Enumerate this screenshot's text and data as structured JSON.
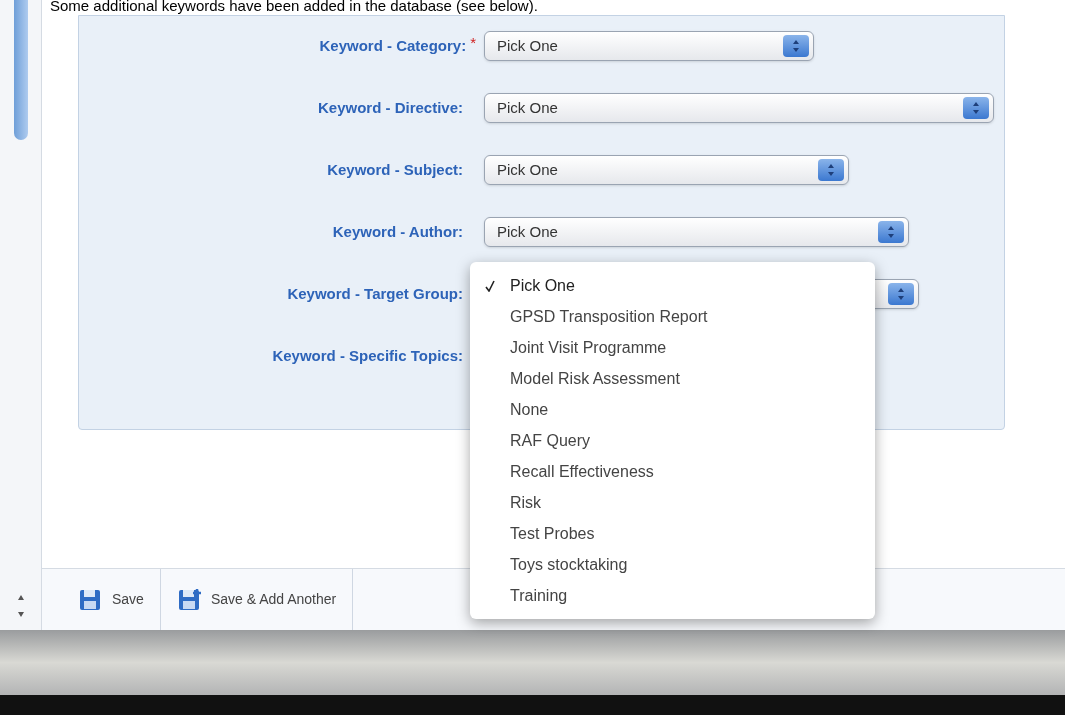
{
  "intro": "Some additional keywords have been added in the database (see below).",
  "fields": [
    {
      "label": "Keyword - Category:",
      "required": true,
      "value": "Pick One"
    },
    {
      "label": "Keyword - Directive:",
      "required": false,
      "value": "Pick One"
    },
    {
      "label": "Keyword - Subject:",
      "required": false,
      "value": "Pick One"
    },
    {
      "label": "Keyword - Author:",
      "required": false,
      "value": "Pick One"
    },
    {
      "label": "Keyword - Target Group:",
      "required": false
    },
    {
      "label": "Keyword - Specific Topics:",
      "required": false
    }
  ],
  "menu": [
    {
      "label": "Pick One",
      "selected": true
    },
    {
      "label": "GPSD Transposition Report",
      "selected": false
    },
    {
      "label": "Joint Visit Programme",
      "selected": false
    },
    {
      "label": "Model Risk Assessment",
      "selected": false
    },
    {
      "label": "None",
      "selected": false
    },
    {
      "label": "RAF Query",
      "selected": false
    },
    {
      "label": "Recall Effectiveness",
      "selected": false
    },
    {
      "label": "Risk",
      "selected": false
    },
    {
      "label": "Test Probes",
      "selected": false
    },
    {
      "label": "Toys stocktaking",
      "selected": false
    },
    {
      "label": "Training",
      "selected": false
    }
  ],
  "required_mark": "*",
  "toolbar": [
    "Save",
    "Save & Add Another"
  ]
}
